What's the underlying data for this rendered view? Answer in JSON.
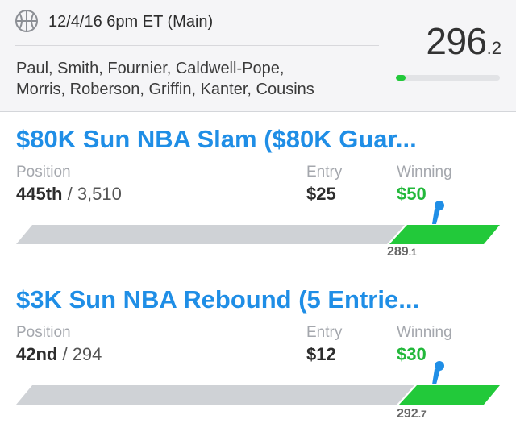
{
  "header": {
    "slate": "12/4/16 6pm ET (Main)",
    "players_line1": "Paul, Smith, Fournier, Caldwell-Pope,",
    "players_line2": "Morris, Roberson, Griffin, Kanter, Cousins",
    "score_int": "296",
    "score_dec": ".2",
    "progress_fraction": 0.09,
    "icon": "basketball-icon"
  },
  "contests": [
    {
      "title": "$80K Sun NBA Slam ($80K Guar...",
      "position_label": "Position",
      "position": "445th",
      "position_total": " / 3,510",
      "entry_label": "Entry",
      "entry": "$25",
      "winning_label": "Winning",
      "winning": "$50",
      "cutline_int": "289",
      "cutline_dec": ".1",
      "paid_fraction": 0.23,
      "user_fraction": 0.87
    },
    {
      "title": "$3K Sun NBA Rebound (5 Entrie...",
      "position_label": "Position",
      "position": "42nd",
      "position_total": " / 294",
      "entry_label": "Entry",
      "entry": "$12",
      "winning_label": "Winning",
      "winning": "$30",
      "cutline_int": "292",
      "cutline_dec": ".7",
      "paid_fraction": 0.21,
      "user_fraction": 0.87
    }
  ],
  "colors": {
    "accent": "#1f8ee6",
    "win": "#22c93a",
    "bar_gray": "#cfd2d6",
    "marker": "#1f8ee6"
  }
}
